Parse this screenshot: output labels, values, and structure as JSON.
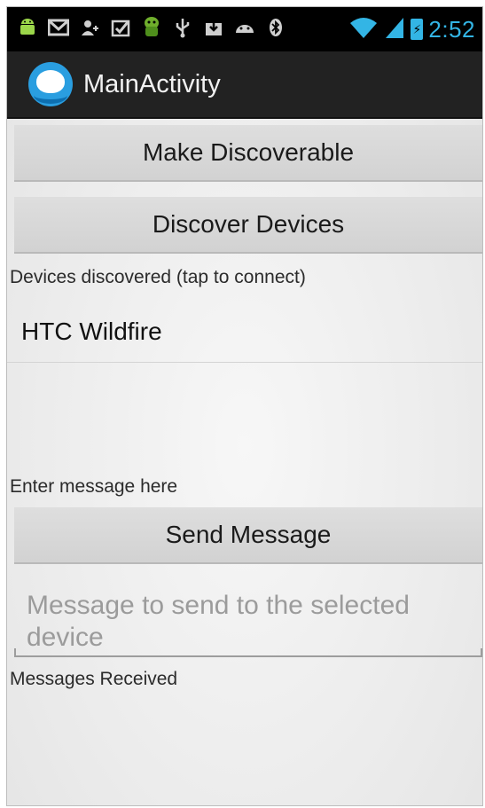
{
  "status_bar": {
    "icons": [
      "android-icon",
      "gmail-icon",
      "contact-icon",
      "task-icon",
      "bugdroid-icon",
      "usb-icon",
      "download-icon",
      "android-debug-icon",
      "bluetooth-icon",
      "wifi-icon",
      "signal-icon",
      "battery-charging-icon"
    ],
    "time": "2:52"
  },
  "action_bar": {
    "title": "MainActivity"
  },
  "buttons": {
    "make_discoverable": "Make Discoverable",
    "discover_devices": "Discover Devices",
    "send_message": "Send Message"
  },
  "devices_label": "Devices discovered (tap to connect)",
  "devices": [
    {
      "name": "HTC Wildfire"
    }
  ],
  "enter_message_label": "Enter message here",
  "message_input": {
    "placeholder": "Message to send to the selected device",
    "value": ""
  },
  "messages_received_label": "Messages Received"
}
